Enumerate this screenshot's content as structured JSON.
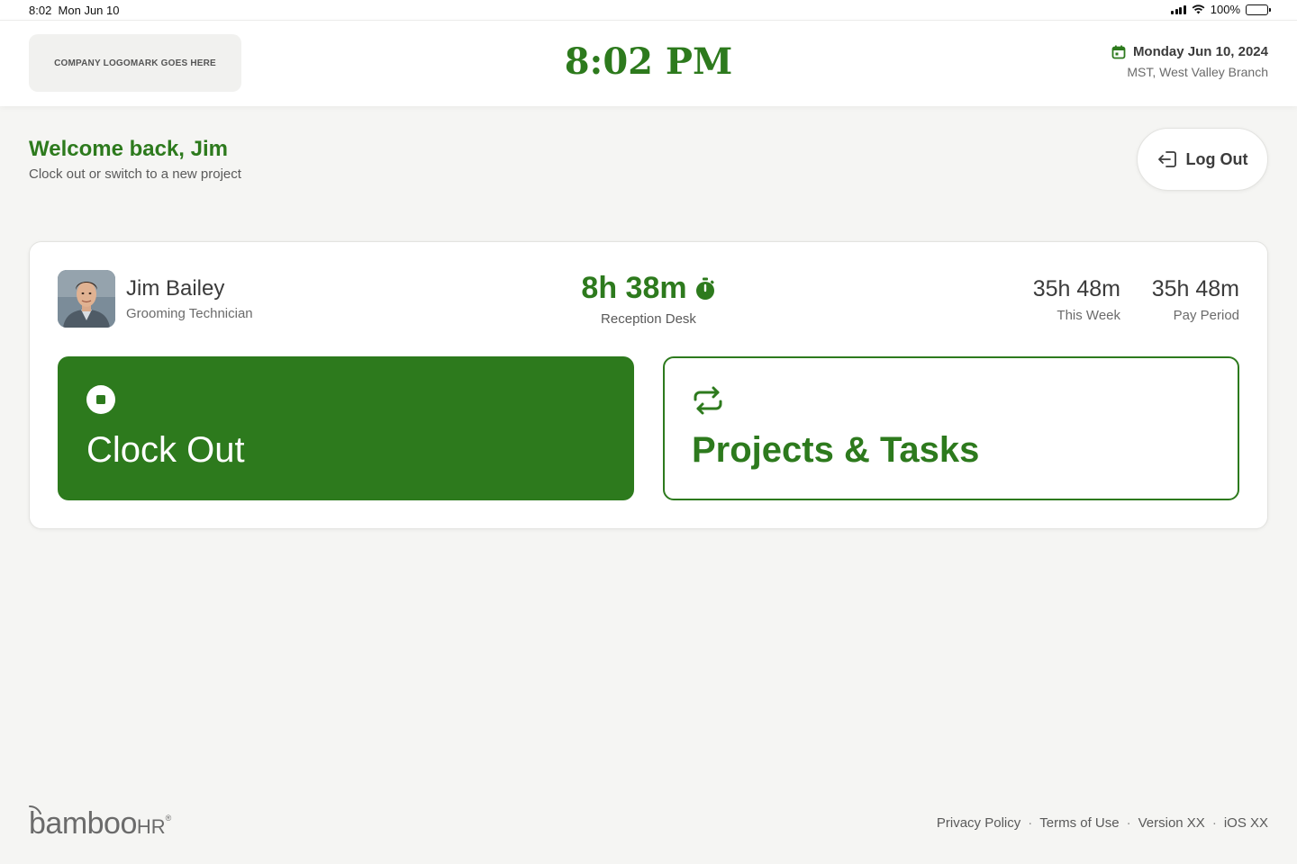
{
  "status_bar": {
    "time": "8:02",
    "date": "Mon Jun 10",
    "battery": "100%"
  },
  "header": {
    "logo_placeholder": "COMPANY LOGOMARK GOES HERE",
    "clock": "8:02 PM",
    "date": "Monday Jun 10, 2024",
    "location": "MST, West Valley Branch"
  },
  "welcome": {
    "title": "Welcome back, Jim",
    "subtitle": "Clock out or switch to a new project"
  },
  "logout": {
    "label": "Log Out"
  },
  "employee": {
    "name": "Jim Bailey",
    "role": "Grooming Technician",
    "current_time": "8h 38m",
    "current_location": "Reception Desk",
    "stats": [
      {
        "value": "35h 48m",
        "label": "This Week"
      },
      {
        "value": "35h 48m",
        "label": "Pay Period"
      }
    ]
  },
  "actions": {
    "clock_out": "Clock Out",
    "projects": "Projects & Tasks"
  },
  "footer": {
    "brand_main": "bamboo",
    "brand_suffix": "HR",
    "brand_mark": "®",
    "links": [
      "Privacy Policy",
      "Terms of Use",
      "Version XX",
      "iOS XX"
    ]
  },
  "colors": {
    "accent": "#2d7a1d",
    "background": "#f5f5f3",
    "text": "#3b3b3b"
  },
  "icons": [
    "calendar-icon",
    "logout-icon",
    "stopwatch-icon",
    "stop-icon",
    "repeat-icon",
    "wifi-icon",
    "battery-icon",
    "signal-icon"
  ]
}
